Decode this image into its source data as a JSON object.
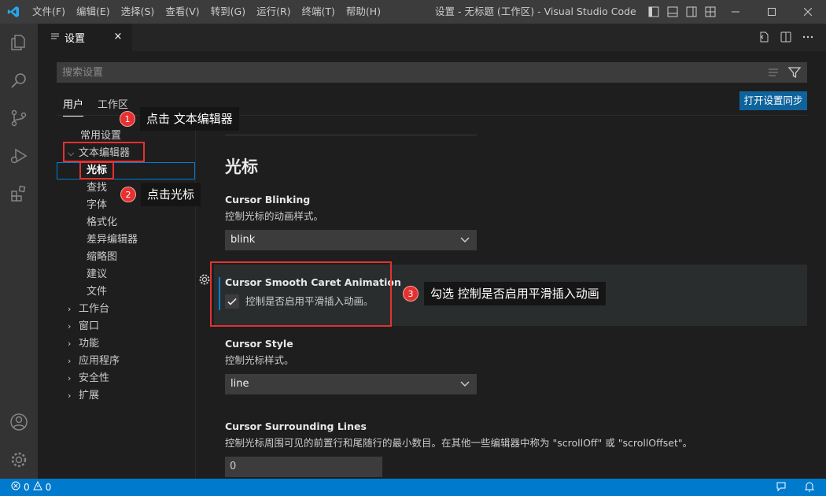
{
  "window": {
    "title": "设置 - 无标题 (工作区) - Visual Studio Code",
    "menu": [
      "文件(F)",
      "编辑(E)",
      "选择(S)",
      "查看(V)",
      "转到(G)",
      "运行(R)",
      "终端(T)",
      "帮助(H)"
    ]
  },
  "tab": {
    "label": "设置",
    "close": "×"
  },
  "search": {
    "placeholder": "搜索设置"
  },
  "scope_tabs": {
    "user": "用户",
    "workspace": "工作区"
  },
  "sync_button": "打开设置同步",
  "toc": {
    "common": "常用设置",
    "text_editor": "文本编辑器",
    "children": [
      "光标",
      "查找",
      "字体",
      "格式化",
      "差异编辑器",
      "缩略图",
      "建议",
      "文件"
    ],
    "collapsed": [
      "工作台",
      "窗口",
      "功能",
      "应用程序",
      "安全性",
      "扩展"
    ]
  },
  "settings": {
    "section_title": "光标",
    "blinking": {
      "title": "Cursor Blinking",
      "desc": "控制光标的动画样式。",
      "value": "blink"
    },
    "smooth": {
      "title": "Cursor Smooth Caret Animation",
      "desc": "控制是否启用平滑插入动画。",
      "checked": true
    },
    "style": {
      "title": "Cursor Style",
      "desc": "控制光标样式。",
      "value": "line"
    },
    "surrounding": {
      "title": "Cursor Surrounding Lines",
      "desc": "控制光标周围可见的前置行和尾随行的最小数目。在其他一些编辑器中称为 \"scrollOff\" 或 \"scrollOffset\"。",
      "value": "0"
    }
  },
  "annotations": [
    {
      "num": "1",
      "text": "点击 文本编辑器"
    },
    {
      "num": "2",
      "text": "点击光标"
    },
    {
      "num": "3",
      "text": "勾选 控制是否启用平滑插入动画"
    }
  ],
  "status": {
    "errors": "0",
    "warnings": "0"
  },
  "colors": {
    "accent": "#007acc",
    "annotation": "#e5312f",
    "button": "#0e639c"
  }
}
